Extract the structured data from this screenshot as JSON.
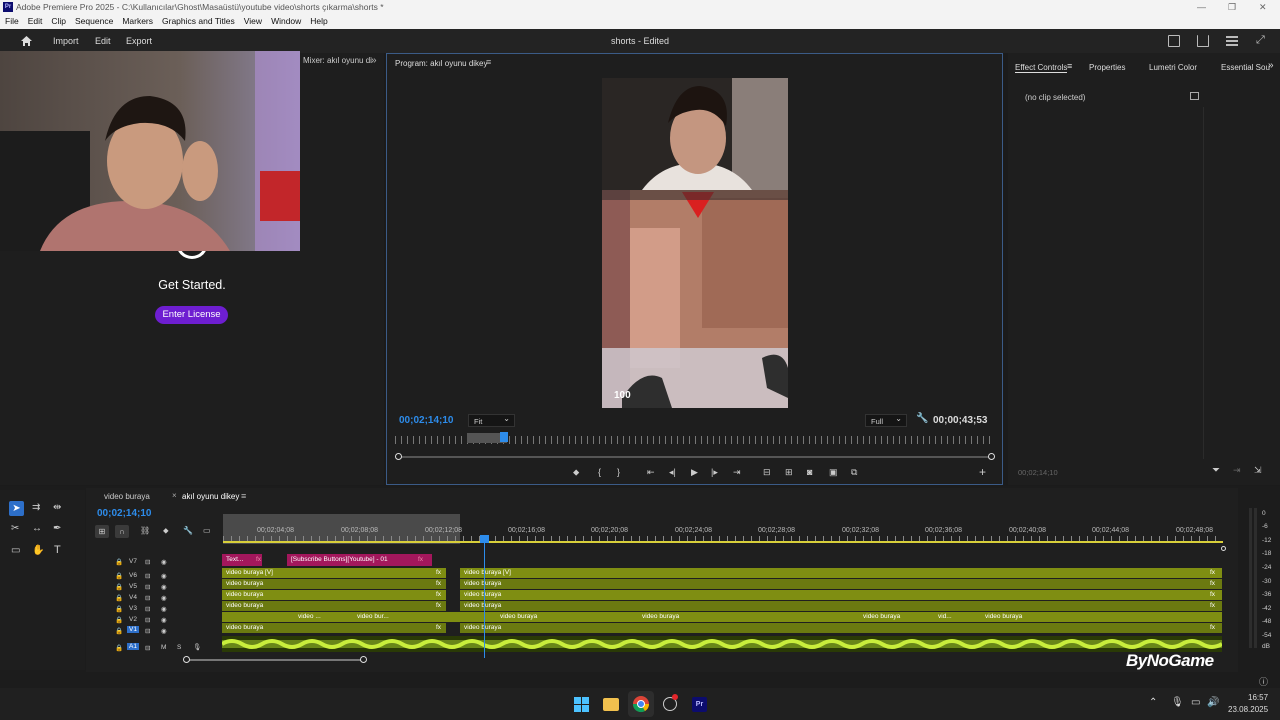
{
  "window": {
    "title": "Adobe Premiere Pro 2025 - C:\\Kullanıcılar\\Ghost\\Masaüstü\\youtube video\\shorts çıkarma\\shorts *",
    "app_badge": "Pr"
  },
  "menu": [
    "File",
    "Edit",
    "Clip",
    "Sequence",
    "Markers",
    "Graphics and Titles",
    "View",
    "Window",
    "Help"
  ],
  "header": {
    "nav": [
      "Import",
      "Edit",
      "Export"
    ],
    "title": "shorts - Edited"
  },
  "left": {
    "mixer_label": "Mixer: akıl oyunu di",
    "get_started": "Get Started.",
    "license_button": "Enter License"
  },
  "program": {
    "header": "Program: akıl oyunu dikey",
    "timecode": "00;02;14;10",
    "fit": "Fit",
    "quality": "Full",
    "duration": "00;00;43;53",
    "hud_number": "100",
    "playhead_fraction": 0.2
  },
  "effect": {
    "tabs": [
      "Effect Controls",
      "Properties",
      "Lumetri Color",
      "Essential Sou"
    ],
    "no_clip": "(no clip selected)",
    "footer_tc": "00;02;14;10"
  },
  "timeline": {
    "tabs": [
      "video buraya",
      "akıl oyunu dikey"
    ],
    "timecode": "00;02;14;10",
    "ruler": [
      "00;02;04;08",
      "00;02;08;08",
      "00;02;12;08",
      "00;02;16;08",
      "00;02;20;08",
      "00;02;24;08",
      "00;02;28;08",
      "00;02;32;08",
      "00;02;36;08",
      "00;02;40;08",
      "00;02;44;08",
      "00;02;48;08"
    ],
    "tracks": [
      "V7",
      "V6",
      "V5",
      "V4",
      "V3",
      "V2",
      "V1",
      "A1"
    ],
    "clips": {
      "v7a": "Text...",
      "v7b": "[Subscribe Buttons][Youtube] - 01",
      "v6a": "video buraya [V]",
      "v6b": "video buraya [V]",
      "generic": "video buraya",
      "v2a": "video ...",
      "v2b": "video bur...",
      "v2c": "vid..."
    },
    "fx": "fx"
  },
  "meters": [
    "0",
    "-6",
    "-12",
    "-18",
    "-24",
    "-30",
    "-36",
    "-42",
    "-48",
    "-54",
    "dB"
  ],
  "watermark": "ByNoGame",
  "taskbar": {
    "time": "16:57",
    "date": "23.08.2025"
  },
  "colors": {
    "accent": "#2d8ceb",
    "clip_green": "#7f8e12",
    "clip_pink": "#a3175c",
    "license_purple": "#6e1ed1"
  }
}
